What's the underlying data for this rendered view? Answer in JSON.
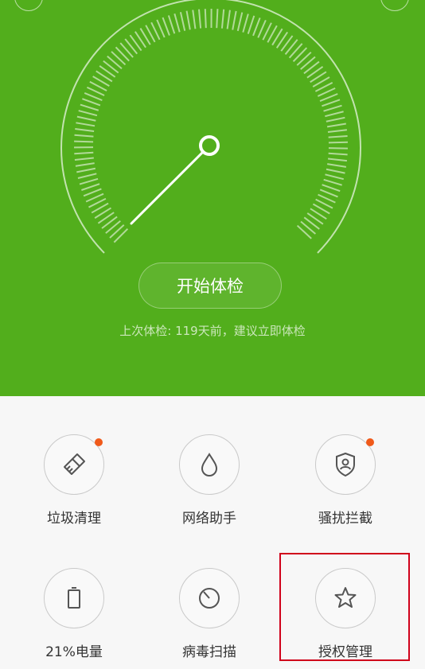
{
  "colors": {
    "hero_green": "#52ae1c",
    "badge_orange": "#f05a1a",
    "highlight_red": "#d0021b",
    "icon_gray": "#555555"
  },
  "gauge": {
    "needle_icon": "speedometer-needle"
  },
  "hero": {
    "start_button_label": "开始体检",
    "last_check_text": "上次体检: 119天前，建议立即体检"
  },
  "tools": [
    {
      "label": "垃圾清理",
      "icon": "broom-icon",
      "has_badge": true
    },
    {
      "label": "网络助手",
      "icon": "drop-icon",
      "has_badge": false
    },
    {
      "label": "骚扰拦截",
      "icon": "shield-user-icon",
      "has_badge": true
    },
    {
      "label": "21%电量",
      "icon": "battery-icon",
      "has_badge": false
    },
    {
      "label": "病毒扫描",
      "icon": "scan-icon",
      "has_badge": false
    },
    {
      "label": "授权管理",
      "icon": "star-icon",
      "has_badge": false,
      "highlighted": true
    }
  ]
}
